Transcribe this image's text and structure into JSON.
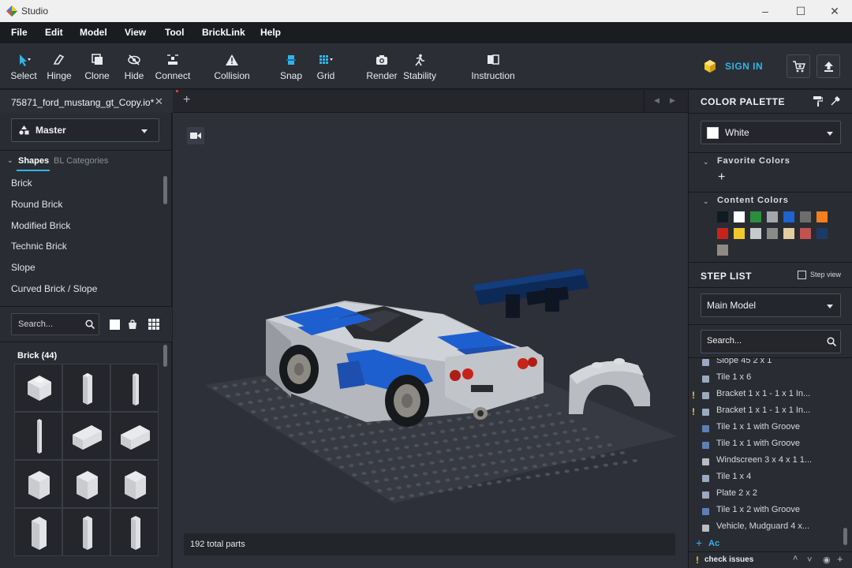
{
  "window": {
    "title": "Studio"
  },
  "menu": [
    "File",
    "Edit",
    "Model",
    "View",
    "Tool",
    "BrickLink",
    "Help"
  ],
  "toolbar": {
    "tools": [
      {
        "name": "select",
        "label": "Select"
      },
      {
        "name": "hinge",
        "label": "Hinge"
      },
      {
        "name": "clone",
        "label": "Clone"
      },
      {
        "name": "hide",
        "label": "Hide"
      },
      {
        "name": "connect",
        "label": "Connect"
      },
      {
        "name": "collision",
        "label": "Collision"
      },
      {
        "name": "snap",
        "label": "Snap"
      },
      {
        "name": "grid",
        "label": "Grid"
      },
      {
        "name": "render",
        "label": "Render"
      },
      {
        "name": "stability",
        "label": "Stability"
      },
      {
        "name": "instruction",
        "label": "Instruction"
      }
    ],
    "sign_in": "SIGN IN"
  },
  "document": {
    "tab_name": "75871_ford_mustang_gt_Copy.io*"
  },
  "left_panel": {
    "model_selector": "Master",
    "tabs": {
      "shapes": "Shapes",
      "bl_categories": "BL Categories"
    },
    "categories": [
      "Brick",
      "Round Brick",
      "Modified Brick",
      "Technic Brick",
      "Slope",
      "Curved Brick / Slope"
    ],
    "search_placeholder": "Search...",
    "brick_group_label": "Brick (44)"
  },
  "viewport": {
    "parts_count": "192 total parts"
  },
  "right_panel": {
    "color_palette_title": "COLOR PALETTE",
    "selected_color": "White",
    "favorite_colors_label": "Favorite Colors",
    "content_colors_label": "Content Colors",
    "content_colors": [
      "#0f1b24",
      "#ffffff",
      "#2a8f3c",
      "#a3a6aa",
      "#1e63d0",
      "#6d6e6c",
      "#f57f1d",
      "#c8231a",
      "#f2c82b",
      "#c7c9cb",
      "#8a8b87",
      "#e4cd9e",
      "#c2534f",
      "#1d3a66",
      "#8f8b84"
    ],
    "step_list_title": "STEP LIST",
    "step_view_label": "Step view",
    "model_dropdown": "Main Model",
    "search_placeholder": "Search...",
    "steps": [
      {
        "label": "Slope 45 2 x 1",
        "warn": false,
        "color": "#9aa9c0"
      },
      {
        "label": "Tile 1 x 6",
        "warn": false,
        "color": "#9aa9c0"
      },
      {
        "label": "Bracket 1 x 1 - 1 x 1 In...",
        "warn": true,
        "color": "#9aa9c0"
      },
      {
        "label": "Bracket 1 x 1 - 1 x 1 In...",
        "warn": true,
        "color": "#9aa9c0"
      },
      {
        "label": "Tile 1 x 1 with Groove",
        "warn": false,
        "color": "#5d7fb5"
      },
      {
        "label": "Tile 1 x 1 with Groove",
        "warn": false,
        "color": "#5d7fb5"
      },
      {
        "label": "Windscreen 3 x 4 x 1 1...",
        "warn": false,
        "color": "#b8bcc4"
      },
      {
        "label": "Tile 1 x 4",
        "warn": false,
        "color": "#9aa9c0"
      },
      {
        "label": "Plate 2 x 2",
        "warn": false,
        "color": "#9aa9c0"
      },
      {
        "label": "Tile 1 x 2 with Groove",
        "warn": false,
        "color": "#5d7fb5"
      },
      {
        "label": "Vehicle, Mudguard 4 x...",
        "warn": false,
        "color": "#b8bcc4"
      }
    ],
    "add_label": "Ac",
    "check_issues": "check issues"
  },
  "colors": {
    "accent": "#2fb6e8",
    "warning": "#f3cb2b",
    "brick_blue": "#1e5fd0"
  }
}
